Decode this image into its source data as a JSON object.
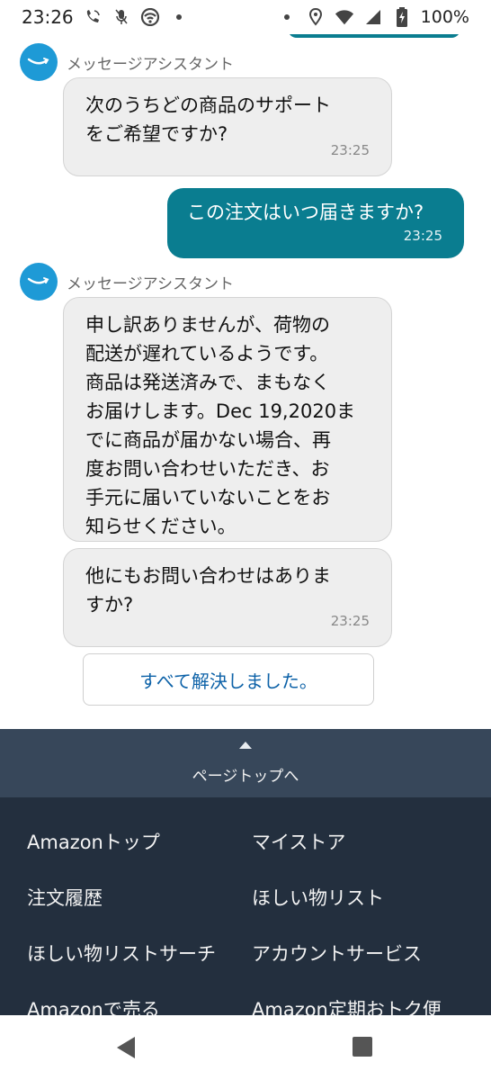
{
  "status_bar": {
    "time": "23:26",
    "battery": "100%"
  },
  "chat": {
    "assistant_name": "メッセージアシスタント",
    "messages": [
      {
        "from": "assistant",
        "lines": [
          "次のうちどの商品のサポート",
          "をご希望ですか?"
        ],
        "time": "23:25"
      },
      {
        "from": "user",
        "lines": [
          "この注文はいつ届きますか?"
        ],
        "time": "23:25"
      },
      {
        "from": "assistant",
        "lines": [
          "申し訳ありませんが、荷物の",
          "配送が遅れているようです。",
          "商品は発送済みで、まもなく",
          "お届けします。Dec 19,2020ま",
          "でに商品が届かない場合、再",
          "度お問い合わせいただき、お",
          "手元に届いていないことをお",
          "知らせください。"
        ]
      },
      {
        "from": "assistant",
        "lines": [
          "他にもお問い合わせはありま",
          "すか?"
        ],
        "time": "23:25"
      }
    ],
    "resolve_button": "すべて解決しました。"
  },
  "page_top": {
    "label": "ページトップへ"
  },
  "footer": {
    "links": [
      "Amazonトップ",
      "マイストア",
      "注文履歴",
      "ほしい物リスト",
      "ほしい物リストサーチ",
      "アカウントサービス",
      "Amazonで売る",
      "Amazon定期おトク便"
    ]
  },
  "colors": {
    "accent": "#0a7d90",
    "avatar": "#1e9ad6",
    "link_blue": "#0d62a8",
    "footer_bg": "#232f3e",
    "pagetop_bg": "#37475a"
  },
  "icons": [
    "wifi-calling-icon",
    "mic-off-icon",
    "wifi-icon",
    "dot-icon",
    "location-icon",
    "wifi-signal-icon",
    "cell-signal-icon",
    "battery-charging-icon",
    "amazon-smile-icon",
    "back-nav-icon",
    "recent-apps-icon"
  ]
}
